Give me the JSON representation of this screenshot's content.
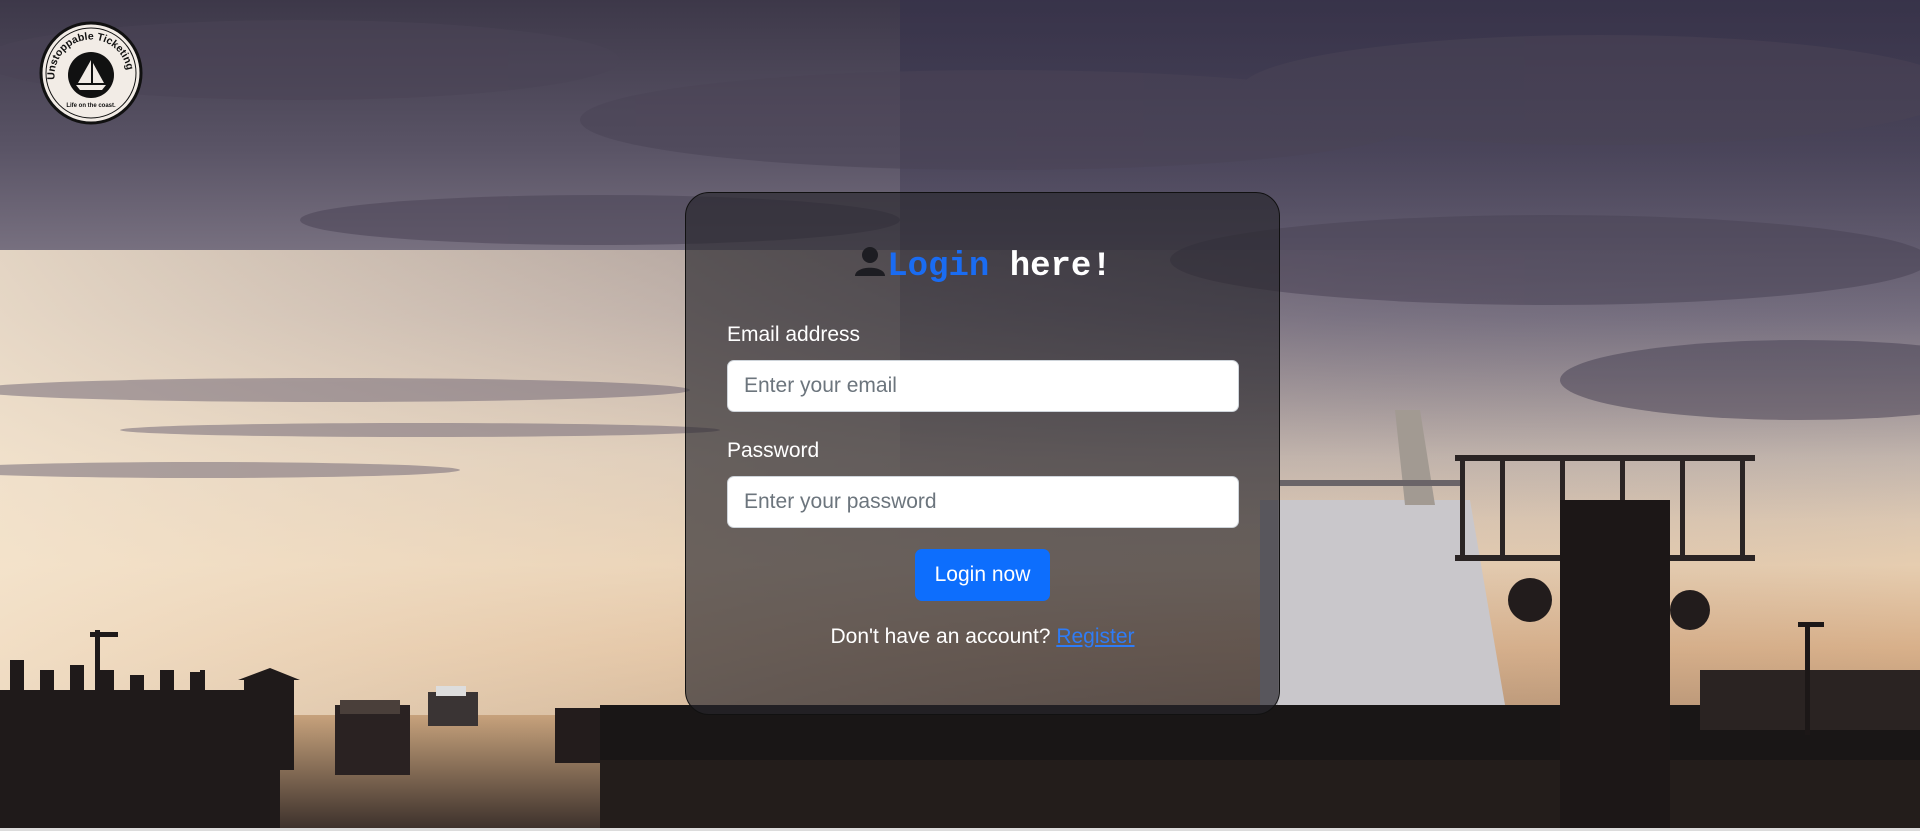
{
  "logo": {
    "arc_text": "Unstoppable Ticketing",
    "tagline": "Life on the coast."
  },
  "login_card": {
    "title_icon": "user-icon",
    "title_accent": "Login",
    "title_rest": " here!",
    "email_label": "Email address",
    "email_value": "",
    "email_placeholder": "Enter your email",
    "password_label": "Password",
    "password_value": "",
    "password_placeholder": "Enter your password",
    "login_button": "Login now",
    "register_prompt": "Don't have an account?",
    "register_link": "Register"
  },
  "colors": {
    "accent": "#1a6cf2",
    "button": "#0d6efd",
    "link": "#2f7cf6"
  }
}
